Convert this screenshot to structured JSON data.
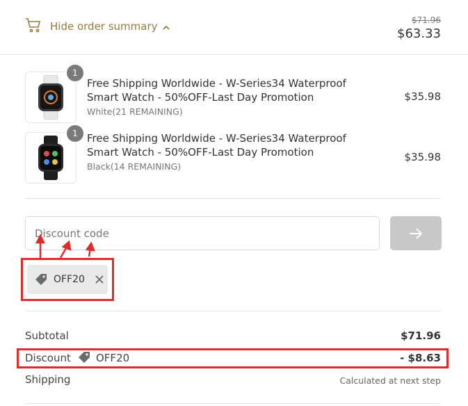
{
  "header": {
    "toggle_label": "Hide order summary",
    "compare_at_price": "$71.96",
    "total_price": "$63.33"
  },
  "items": [
    {
      "quantity": "1",
      "title": "Free Shipping Worldwide - W-Series34 Waterproof Smart Watch - 50%OFF-Last Day Promotion",
      "variant": "White(21 REMAINING)",
      "price": "$35.98",
      "thumb_color": "white"
    },
    {
      "quantity": "1",
      "title": "Free Shipping Worldwide - W-Series34 Waterproof Smart Watch - 50%OFF-Last Day Promotion",
      "variant": "Black(14 REMAINING)",
      "price": "$35.98",
      "thumb_color": "black"
    }
  ],
  "discount": {
    "placeholder": "Discount code",
    "applied_code": "OFF20"
  },
  "totals": {
    "subtotal_label": "Subtotal",
    "subtotal_value": "$71.96",
    "discount_label": "Discount",
    "discount_code": "OFF20",
    "discount_value": "- $8.63",
    "shipping_label": "Shipping",
    "shipping_value": "Calculated at next step"
  },
  "colors": {
    "accent": "#9a7a3b",
    "annotation_red": "#e02b2b",
    "button_disabled": "#c8c8c8"
  }
}
